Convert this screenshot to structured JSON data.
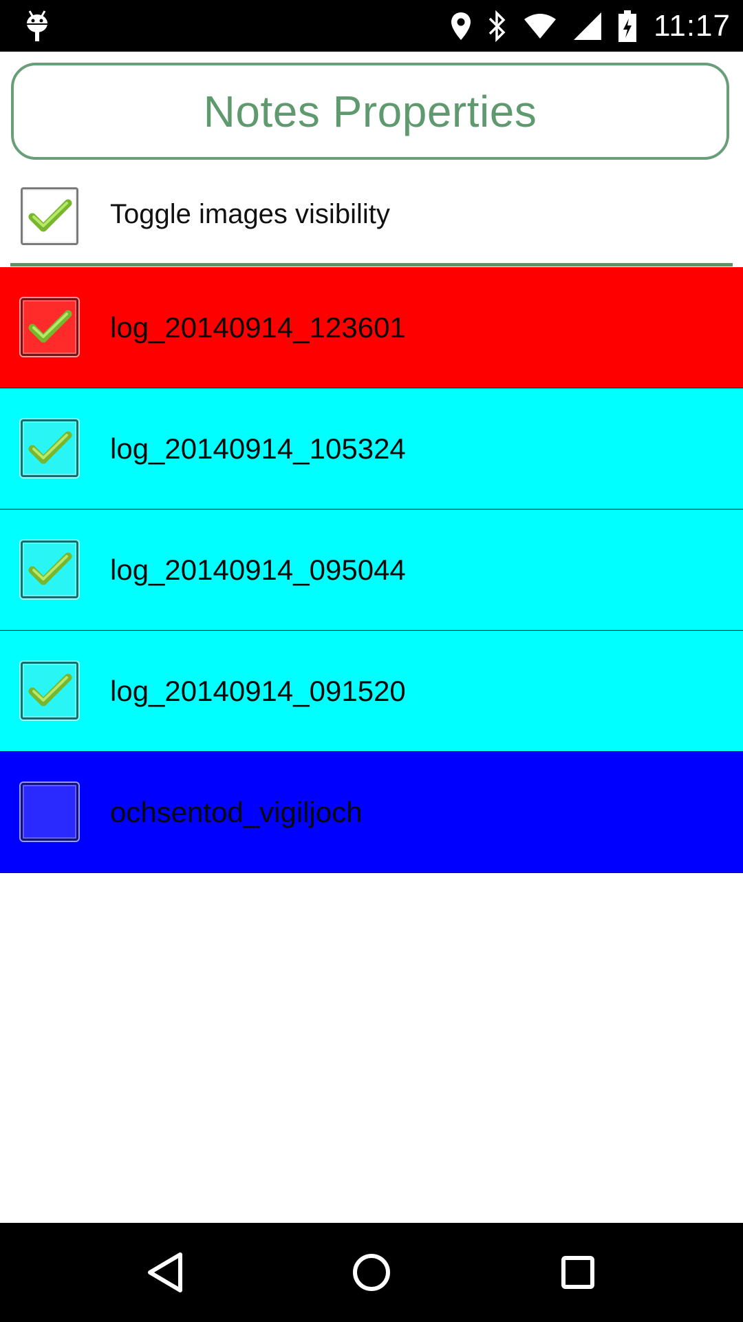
{
  "status_bar": {
    "time": "11:17",
    "icons": [
      "android-debug-icon",
      "location-icon",
      "bluetooth-icon",
      "wifi-icon",
      "cell-signal-icon",
      "battery-charging-icon"
    ]
  },
  "header": {
    "title": "Notes Properties",
    "accent_color": "#5f9a6f"
  },
  "toggle": {
    "label": "Toggle images visibility",
    "checked": true
  },
  "notes": [
    {
      "name": "log_20140914_123601",
      "color": "#ff0000",
      "checked": true
    },
    {
      "name": "log_20140914_105324",
      "color": "#00ffff",
      "checked": true
    },
    {
      "name": "log_20140914_095044",
      "color": "#00ffff",
      "checked": true
    },
    {
      "name": "log_20140914_091520",
      "color": "#00ffff",
      "checked": true
    },
    {
      "name": "ochsentod_vigiljoch",
      "color": "#0000ff",
      "checked": false
    }
  ],
  "nav_bar": {
    "icons": [
      "back-icon",
      "home-icon",
      "recents-icon"
    ]
  }
}
